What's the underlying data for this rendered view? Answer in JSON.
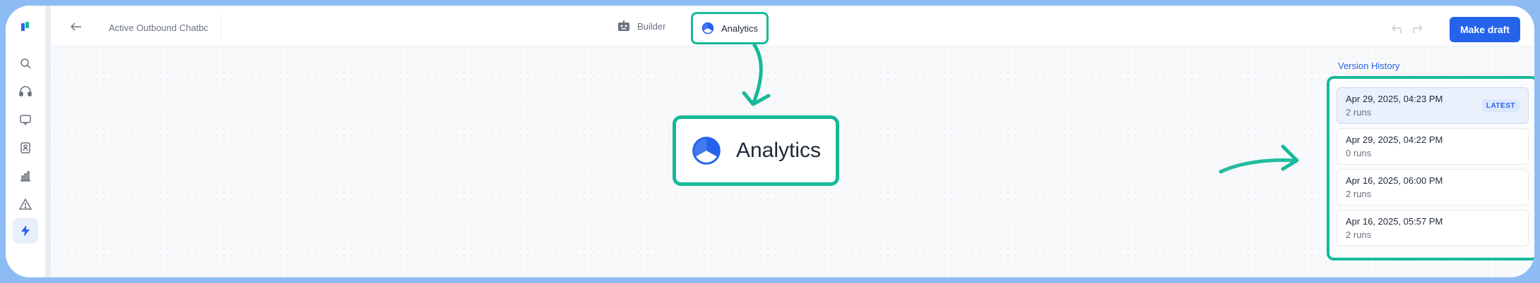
{
  "header": {
    "title": "Active Outbound Chatbo",
    "tabs": [
      {
        "label": "Builder",
        "icon": "robot-icon"
      },
      {
        "label": "Analytics",
        "icon": "pie-chart-icon",
        "active": true
      }
    ],
    "make_draft_label": "Make draft"
  },
  "sidebar": {
    "items": [
      {
        "icon": "logo-icon"
      },
      {
        "icon": "search-icon"
      },
      {
        "icon": "headset-icon"
      },
      {
        "icon": "chat-icon"
      },
      {
        "icon": "contact-icon"
      },
      {
        "icon": "bar-chart-icon"
      },
      {
        "icon": "warning-icon"
      },
      {
        "icon": "lightning-icon",
        "active": true
      }
    ]
  },
  "callout": {
    "label": "Analytics"
  },
  "version_history": {
    "title": "Version History",
    "items": [
      {
        "date": "Apr 29, 2025, 04:23 PM",
        "runs": "2 runs",
        "badge": "LATEST"
      },
      {
        "date": "Apr 29, 2025, 04:22 PM",
        "runs": "0 runs"
      },
      {
        "date": "Apr 16, 2025, 06:00 PM",
        "runs": "2 runs"
      },
      {
        "date": "Apr 16, 2025, 05:57 PM",
        "runs": "2 runs"
      }
    ]
  },
  "colors": {
    "accent": "#2563eb",
    "highlight": "#16b99a",
    "frame": "#8dbcf5"
  }
}
